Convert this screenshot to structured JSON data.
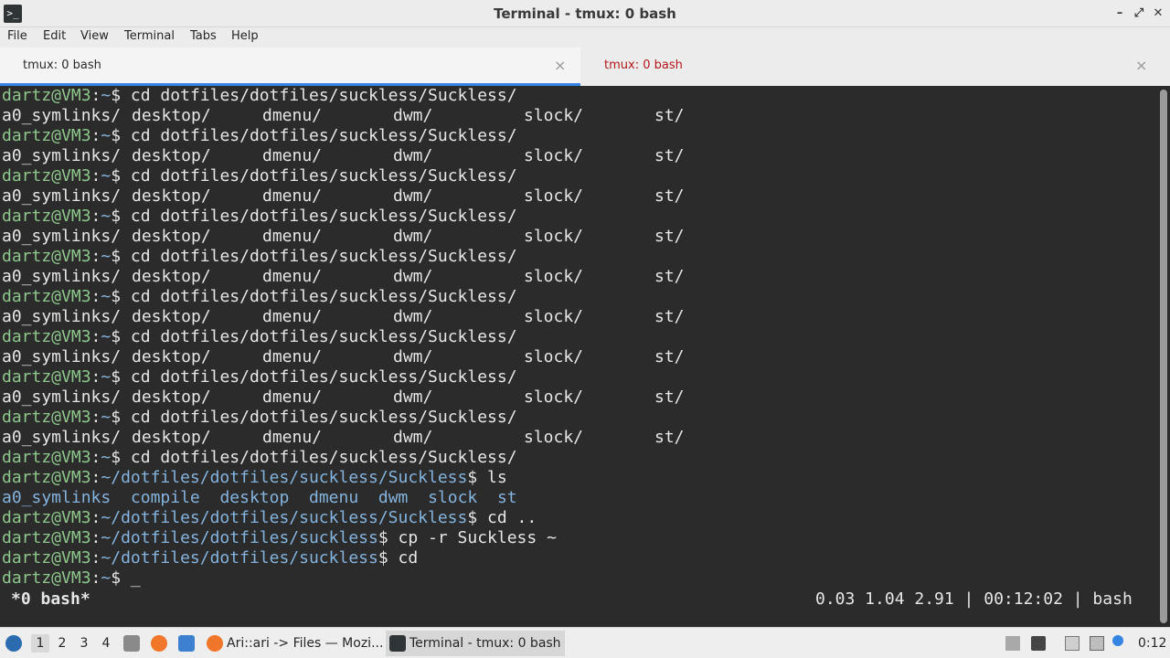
{
  "window": {
    "title": "Terminal - tmux: 0 bash",
    "controls": [
      "–",
      "⤢",
      "✕"
    ]
  },
  "menu": [
    "File",
    "Edit",
    "View",
    "Terminal",
    "Tabs",
    "Help"
  ],
  "tabs": [
    {
      "label": "tmux: 0 bash",
      "active": true
    },
    {
      "label": "tmux: 0 bash",
      "active": false
    }
  ],
  "terminal": {
    "home_prompt": {
      "user": "dartz@VM3",
      "path": "~"
    },
    "repeat_command": "cd dotfiles/dotfiles/suckless/Suckless/",
    "completion_row": [
      "a0_symlinks/",
      "desktop/",
      "dmenu/",
      "dwm/",
      "slock/",
      "st/"
    ],
    "repeat_count": 9,
    "tail": [
      {
        "path": "~",
        "cmd": "cd dotfiles/dotfiles/suckless/Suckless/"
      },
      {
        "path": "~/dotfiles/dotfiles/suckless/Suckless",
        "cmd": "ls"
      }
    ],
    "ls_output": [
      "a0_symlinks",
      "compile",
      "desktop",
      "dmenu",
      "dwm",
      "slock",
      "st"
    ],
    "after": [
      {
        "path": "~/dotfiles/dotfiles/suckless/Suckless",
        "cmd": "cd .."
      },
      {
        "path": "~/dotfiles/dotfiles/suckless",
        "cmd": "cp -r Suckless ~"
      },
      {
        "path": "~/dotfiles/dotfiles/suckless",
        "cmd": "cd"
      },
      {
        "path": "~",
        "cmd": "_"
      }
    ],
    "status_left": "*0 bash*",
    "status_right": "0.03 1.04 2.91 | 00:12:02 | bash"
  },
  "taskbar": {
    "workspaces": [
      "1",
      "2",
      "3",
      "4"
    ],
    "active_workspace": "1",
    "tasks": [
      {
        "label": "Ari::ari -> Files — Mozi...",
        "icon": "firefox-icon"
      },
      {
        "label": "Terminal - tmux: 0 bash",
        "icon": "terminal-icon"
      }
    ],
    "clock": "0:12"
  },
  "colors": {
    "prompt_user": "#8ec78b",
    "prompt_path": "#84b3de",
    "tab_accent": "#3584e4",
    "inactive_tab_text": "#b5171b"
  }
}
